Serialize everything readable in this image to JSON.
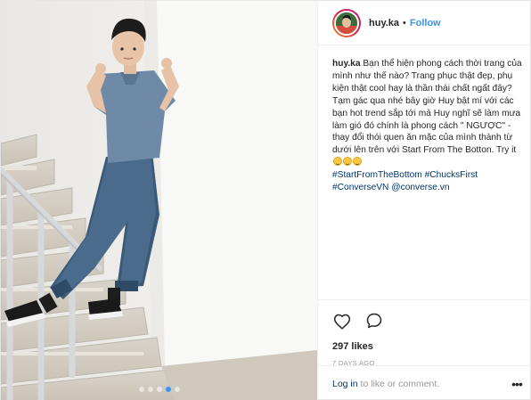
{
  "post": {
    "username": "huy.ka",
    "separator": "•",
    "follow_label": "Follow",
    "photo_icon": "post-photo",
    "carousel": {
      "count": 5,
      "active_index": 3
    }
  },
  "caption": {
    "username": "huy.ka",
    "text": "Bạn thể hiện phong cách thời trang của mình như thế nào? Trang phục thật đẹp, phụ kiện thật cool hay là thần thái chất ngất đây? Tạm gác qua nhé bây giờ Huy bật mí với các bạn hot trend sắp tới mà Huy nghĩ sẽ làm mưa làm gió đó chính là phong cách \" NGƯỢC\" - thay đổi thói quen ăn mặc của mình thành từ dưới lên trên với Start From The Botton. Try it",
    "emoji": "grinning-face-emoji",
    "hashtags": [
      "#StartFromTheBottom",
      "#ChucksFirst",
      "#ConverseVN"
    ],
    "mention": "@converse.vn"
  },
  "actions": {
    "like_icon": "heart-icon",
    "comment_icon": "comment-icon",
    "likes": "297 likes",
    "timestamp": "7 DAYS AGO"
  },
  "footer": {
    "login_link": "Log in",
    "login_text": " to like or comment.",
    "more_icon": "more-options-icon",
    "more_glyph": "•••"
  },
  "colors": {
    "accent": "#3897f0",
    "link": "#003569",
    "muted": "#999999",
    "text": "#262626"
  }
}
